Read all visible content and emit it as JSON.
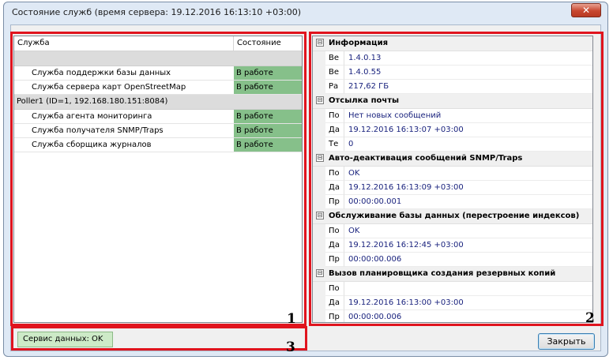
{
  "window": {
    "title": "Состояние служб (время сервера: 19.12.2016 16:13:10 +03:00)",
    "close_glyph": "✕"
  },
  "services": {
    "headers": {
      "service": "Служба",
      "state": "Состояние"
    },
    "top_rows": [
      {
        "name": "Служба поддержки базы данных",
        "state": "В работе"
      },
      {
        "name": "Служба сервера карт OpenStreetMap",
        "state": "В работе"
      }
    ],
    "group": {
      "label": "Poller1 (ID=1, 192.168.180.151:8084)"
    },
    "group_rows": [
      {
        "name": "Служба агента мониторинга",
        "state": "В работе"
      },
      {
        "name": "Служба получателя SNMP/Traps",
        "state": "В работе"
      },
      {
        "name": "Служба сборщика журналов",
        "state": "В работе"
      }
    ],
    "state_color": "#86c08a"
  },
  "info": {
    "toggle": "⊟",
    "sections": [
      {
        "title": "Информация",
        "props": [
          {
            "name": "Ве",
            "value": "1.4.0.13"
          },
          {
            "name": "Ве",
            "value": "1.4.0.55"
          },
          {
            "name": "Ра",
            "value": "217,62 ГБ"
          }
        ]
      },
      {
        "title": "Отсылка почты",
        "props": [
          {
            "name": "По",
            "value": "Нет новых сообщений"
          },
          {
            "name": "Да",
            "value": "19.12.2016 16:13:07 +03:00"
          },
          {
            "name": "Те",
            "value": "0"
          }
        ]
      },
      {
        "title": "Авто-деактивация сообщений SNMP/Traps",
        "props": [
          {
            "name": "По",
            "value": "OK"
          },
          {
            "name": "Да",
            "value": "19.12.2016 16:13:09 +03:00"
          },
          {
            "name": "Пр",
            "value": "00:00:00.001"
          }
        ]
      },
      {
        "title": "Обслуживание базы данных (перестроение индексов)",
        "props": [
          {
            "name": "По",
            "value": "OK"
          },
          {
            "name": "Да",
            "value": "19.12.2016 16:12:45 +03:00"
          },
          {
            "name": "Пр",
            "value": "00:00:00.006"
          }
        ]
      },
      {
        "title": "Вызов планировщика создания резервных копий",
        "props": [
          {
            "name": "По",
            "value": ""
          },
          {
            "name": "Да",
            "value": "19.12.2016 16:13:00 +03:00"
          },
          {
            "name": "Пр",
            "value": "00:00:00.006"
          }
        ]
      }
    ]
  },
  "footer": {
    "status": "Сервис данных: OK",
    "close_label": "Закрыть"
  },
  "callouts": {
    "one": "1",
    "two": "2",
    "three": "3"
  },
  "highlight_color": "#e0141e"
}
